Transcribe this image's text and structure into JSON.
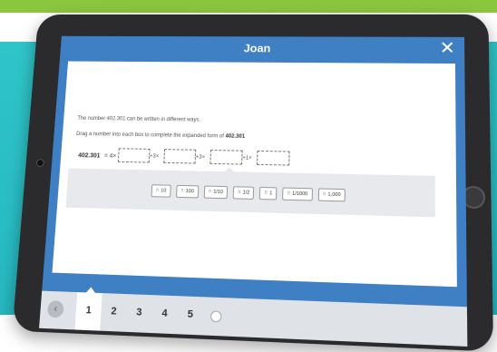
{
  "header": {
    "title": "Joan",
    "close_label": "✕"
  },
  "question": {
    "prompt": "The number 402.301 can be written in different ways.",
    "instruction_pre": "Drag a number into each box to complete the expanded form of",
    "instruction_number": "402.301",
    "number": "402.301",
    "equals_prefix": "= 4×",
    "ops": [
      "+3×",
      "+3×",
      "+1×"
    ]
  },
  "tiles": [
    {
      "label": "10"
    },
    {
      "label": "100"
    },
    {
      "label": "1/10"
    },
    {
      "label": "1/2"
    },
    {
      "label": "1"
    },
    {
      "label": "1/1000"
    },
    {
      "label": "1,000"
    }
  ],
  "tile_grip": "⠿",
  "nav": {
    "prev_label": "‹",
    "pages": [
      "1",
      "2",
      "3",
      "4",
      "5"
    ],
    "active_page": "1"
  },
  "colors": {
    "top_green": "#8cc63f",
    "background_teal": "#2ec4c8",
    "header_blue": "#3f7fc3",
    "tablet_frame": "#2b2b2e"
  }
}
